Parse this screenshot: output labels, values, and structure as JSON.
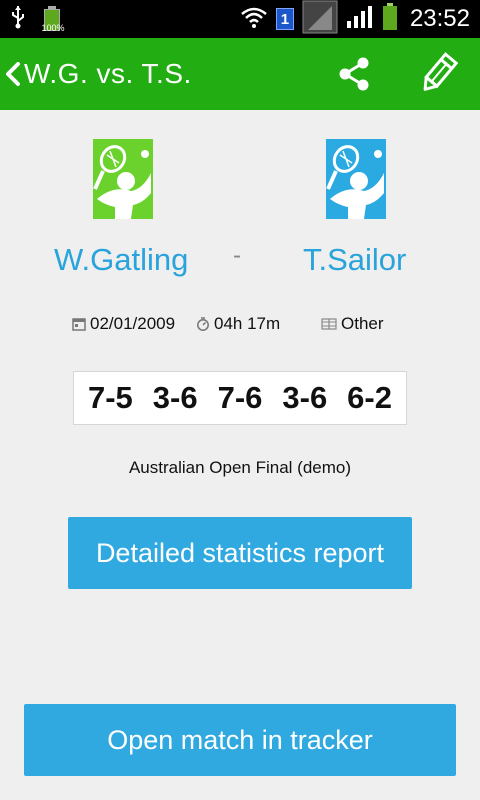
{
  "status_bar": {
    "battery_percent_label": "100%",
    "sim_number": "1",
    "time": "23:52"
  },
  "app_bar": {
    "title": "W.G. vs. T.S.",
    "back_icon": "chevron-left-icon",
    "share_icon": "share-icon",
    "edit_icon": "pencil-icon"
  },
  "players": {
    "player1": {
      "name": "W.Gatling",
      "avatar_color": "#6bd22d"
    },
    "separator": "-",
    "player2": {
      "name": "T.Sailor",
      "avatar_color": "#2aaae1"
    }
  },
  "match_info": {
    "date": "02/01/2009",
    "duration": "04h 17m",
    "surface": "Other"
  },
  "score": {
    "sets": [
      "7-5",
      "3-6",
      "7-6",
      "3-6",
      "6-2"
    ]
  },
  "description": "Australian Open Final (demo)",
  "buttons": {
    "stats_label": "Detailed statistics report",
    "open_label": "Open match in tracker"
  },
  "colors": {
    "app_bar": "#22ad12",
    "accent_blue": "#2fa9e0",
    "player_name": "#28a3dc"
  }
}
